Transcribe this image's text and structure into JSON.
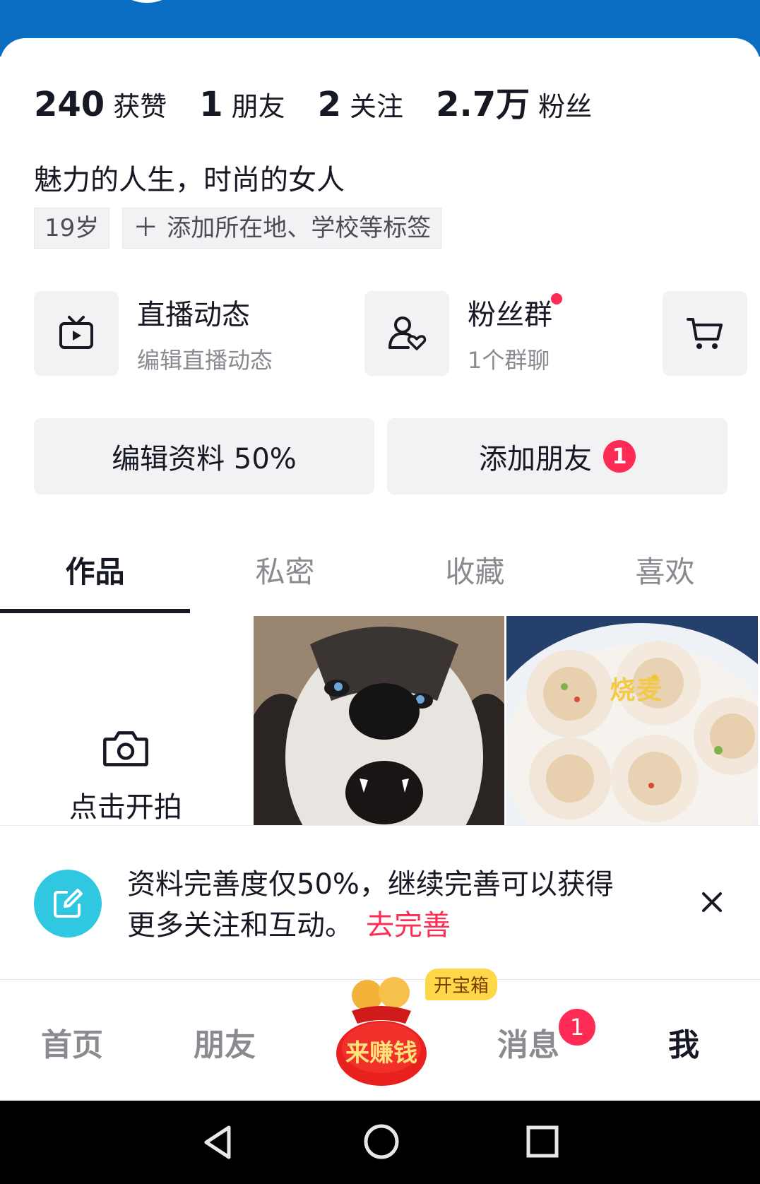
{
  "stats": [
    {
      "num": "240",
      "label": "获赞"
    },
    {
      "num": "1",
      "label": "朋友"
    },
    {
      "num": "2",
      "label": "关注"
    },
    {
      "num": "2.7万",
      "label": "粉丝"
    }
  ],
  "bio": "魅力的人生，时尚的女人",
  "tags": {
    "age": "19岁",
    "add": "添加所在地、学校等标签"
  },
  "features": [
    {
      "title": "直播动态",
      "subtitle": "编辑直播动态",
      "icon": "tv-icon"
    },
    {
      "title": "粉丝群",
      "subtitle": "1个群聊",
      "icon": "user-heart-icon"
    },
    {
      "icon": "cart-icon"
    }
  ],
  "actions": {
    "edit": "编辑资料 50%",
    "add_friend": "添加朋友",
    "add_friend_badge": "1"
  },
  "tabs": [
    "作品",
    "私密",
    "收藏",
    "喜欢"
  ],
  "grid": {
    "shoot_label": "点击开拍",
    "food_caption": "烧麦"
  },
  "banner": {
    "text": "资料完善度仅50%，继续完善可以获得更多关注和互动。",
    "link": "去完善"
  },
  "nav": {
    "home": "首页",
    "friends": "朋友",
    "earn": "来赚钱",
    "earn_tag": "开宝箱",
    "messages": "消息",
    "messages_badge": "1",
    "me": "我"
  },
  "colors": {
    "accent": "#fe2c55",
    "top_band": "#0a6fc2",
    "banner_icon": "#2fc8e0"
  }
}
